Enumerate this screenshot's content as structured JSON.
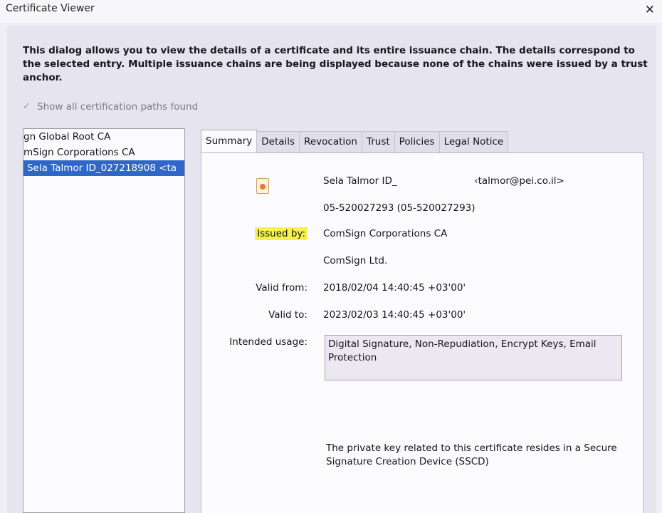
{
  "window": {
    "title": "Certificate Viewer",
    "close_glyph": "✕"
  },
  "description": "This dialog allows you to view the details of a certificate and its entire issuance chain. The details correspond to the selected entry. Multiple issuance chains are being displayed because none of the chains were issued by a trust anchor.",
  "show_all_paths": {
    "label": "Show all certification paths found",
    "checked": true,
    "disabled": true
  },
  "tree": {
    "items": [
      {
        "label": "gn Global Root CA",
        "selected": false
      },
      {
        "label": "mSign Corporations CA",
        "selected": false
      },
      {
        "label": "Sela Talmor ID_027218908 <ta",
        "selected": true
      }
    ]
  },
  "tabs": [
    {
      "label": "Summary",
      "active": true
    },
    {
      "label": "Details",
      "active": false
    },
    {
      "label": "Revocation",
      "active": false
    },
    {
      "label": "Trust",
      "active": false
    },
    {
      "label": "Policies",
      "active": false
    },
    {
      "label": "Legal Notice",
      "active": false
    }
  ],
  "summary": {
    "subject_name": "Sela Talmor ID_",
    "subject_email": "‹talmor@pei.co.il>",
    "subject_id": "05-520027293 (05-520027293)",
    "issued_by_label": "Issued by:",
    "issuer_cn": "ComSign Corporations CA",
    "issuer_org": "ComSign Ltd.",
    "valid_from_label": "Valid from:",
    "valid_from": "2018/02/04 14:40:45 +03'00'",
    "valid_to_label": "Valid to:",
    "valid_to": "2023/02/03 14:40:45 +03'00'",
    "intended_usage_label": "Intended usage:",
    "intended_usage": "Digital Signature, Non-Repudiation, Encrypt Keys, Email Protection",
    "private_key_note": "The private key related to this certificate resides in a Secure Signature Creation Device (SSCD)"
  },
  "colors": {
    "selection": "#2f67c9",
    "highlight": "#f5f24a",
    "dialog_bg": "#e6e4ef"
  }
}
